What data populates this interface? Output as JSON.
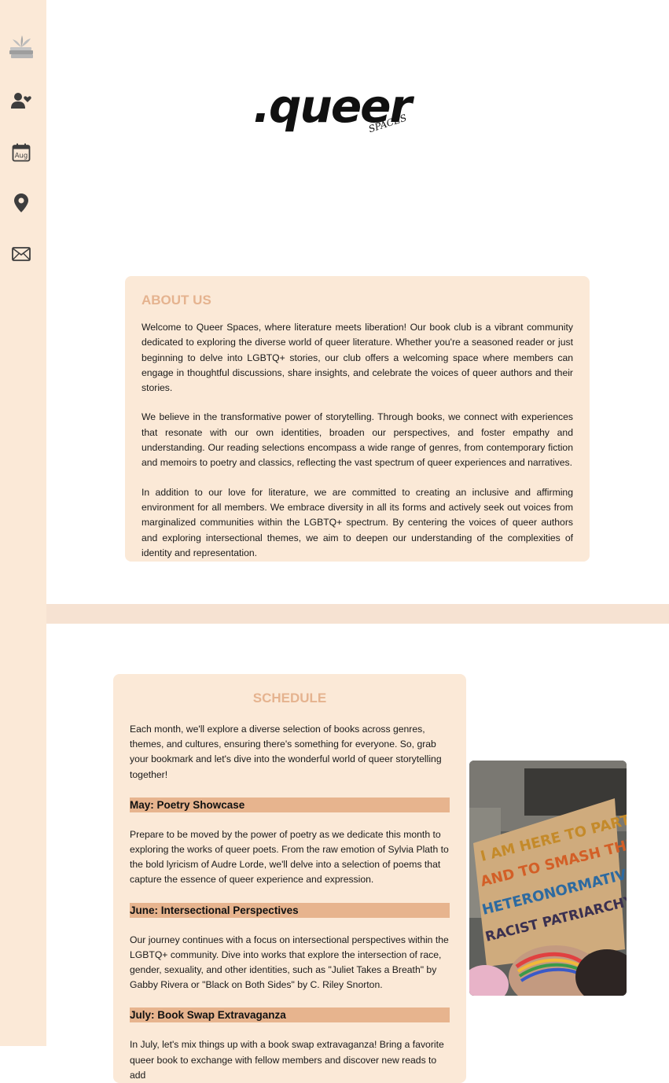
{
  "logo": {
    "main": ".queer",
    "sub": "SPACES"
  },
  "sidebar": {
    "items": [
      {
        "icon": "book-stack-icon"
      },
      {
        "icon": "person-heart-icon"
      },
      {
        "icon": "calendar-icon",
        "label": "Aug"
      },
      {
        "icon": "map-pin-icon"
      },
      {
        "icon": "envelope-icon"
      }
    ]
  },
  "about": {
    "title": "ABOUT US",
    "paragraphs": [
      "Welcome to Queer Spaces, where literature meets liberation! Our book club is a vibrant community dedicated to exploring the diverse world of queer literature. Whether you're a seasoned reader or just beginning to delve into LGBTQ+ stories, our club offers a welcoming space where members can engage in thoughtful discussions, share insights, and celebrate the voices of queer authors and their stories.",
      "We believe in the transformative power of storytelling. Through books, we connect with experiences that resonate with our own identities, broaden our perspectives, and foster empathy and understanding. Our reading selections encompass a wide range of genres, from contemporary fiction and memoirs to poetry and classics, reflecting the vast spectrum of queer experiences and narratives.",
      "In addition to our love for literature, we are committed to creating an inclusive and affirming environment for all members. We embrace diversity in all its forms and actively seek out voices from marginalized communities within the LGBTQ+ spectrum. By centering the voices of queer authors and exploring intersectional themes, we aim to deepen our understanding of the complexities of identity and representation."
    ]
  },
  "schedule": {
    "title": "SCHEDULE",
    "intro": "Each month, we'll explore a diverse selection of books across genres, themes, and cultures, ensuring there's something for everyone. So, grab your bookmark and let's dive into the wonderful world of queer storytelling together!",
    "months": [
      {
        "heading": "May: Poetry Showcase",
        "text": "Prepare to be moved by the power of poetry as we dedicate this month to exploring the works of queer poets. From the raw emotion of Sylvia Plath to the bold lyricism of Audre Lorde, we'll delve into a selection of poems that capture the essence of queer experience and expression."
      },
      {
        "heading": "June: Intersectional Perspectives",
        "text": "Our journey continues with a focus on intersectional perspectives within the LGBTQ+ community. Dive into works that explore the intersection of race, gender, sexuality, and other identities, such as \"Juliet Takes a Breath\" by Gabby Rivera or \"Black on Both Sides\" by C. Riley Snorton."
      },
      {
        "heading": "July: Book Swap Extravaganza",
        "text": "In July, let's mix things up with a book swap extravaganza! Bring a favorite queer book to exchange with fellow members and discover new reads to add"
      }
    ]
  },
  "photo": {
    "sign_lines": [
      "I AM HERE TO PARTY",
      "AND TO SMASH THE",
      "HETERONORMATIVE",
      "RACIST PATRIARCHY"
    ]
  },
  "colors": {
    "sidebar": "#fbe9d7",
    "card": "#fbe9d7",
    "heading_accent": "#e5b38f",
    "month_bar": "#e7b48e",
    "band": "#f6e2d2"
  }
}
